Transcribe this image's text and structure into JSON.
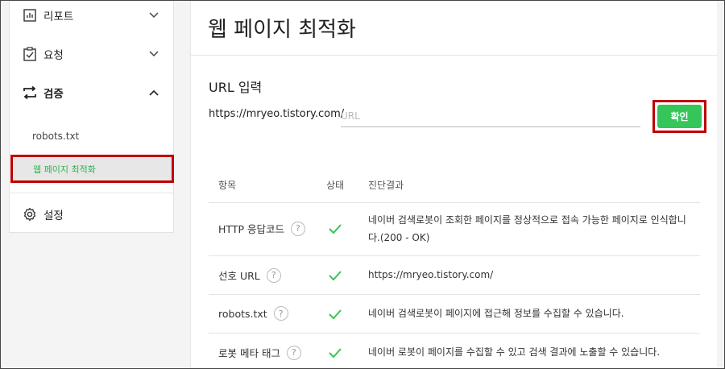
{
  "sidebar": {
    "items": [
      {
        "label": "리포트",
        "icon": "bar-chart-icon",
        "expanded": false
      },
      {
        "label": "요청",
        "icon": "clipboard-check-icon",
        "expanded": false
      },
      {
        "label": "검증",
        "icon": "swap-arrows-icon",
        "expanded": true
      }
    ],
    "subitems": [
      "robots.txt",
      "웹 페이지 최적화"
    ],
    "settings_label": "설정"
  },
  "main": {
    "title": "웹 페이지 최적화",
    "url_heading": "URL 입력",
    "url_prefix": "https://mryeo.tistory.com/",
    "url_placeholder": "URL",
    "url_value": "",
    "confirm_label": "확인",
    "table": {
      "headers": [
        "항목",
        "상태",
        "진단결과"
      ],
      "rows": [
        {
          "item": "HTTP 응답코드",
          "status": "ok",
          "result": "네이버 검색로봇이 조회한 페이지를 정상적으로 접속 가능한 페이지로 인식합니다.(200 - OK)"
        },
        {
          "item": "선호 URL",
          "status": "ok",
          "result": "https://mryeo.tistory.com/"
        },
        {
          "item": "robots.txt",
          "status": "ok",
          "result": "네이버 검색로봇이 페이지에 접근해 정보를 수집할 수 있습니다."
        },
        {
          "item": "로봇 메타 태그",
          "status": "ok",
          "result": "네이버 로봇이 페이지를 수집할 수 있고 검색 결과에 노출할 수 있습니다."
        }
      ]
    }
  },
  "colors": {
    "accent_green": "#35c559",
    "active_text": "#2eb150",
    "highlight_red": "#c00000"
  }
}
